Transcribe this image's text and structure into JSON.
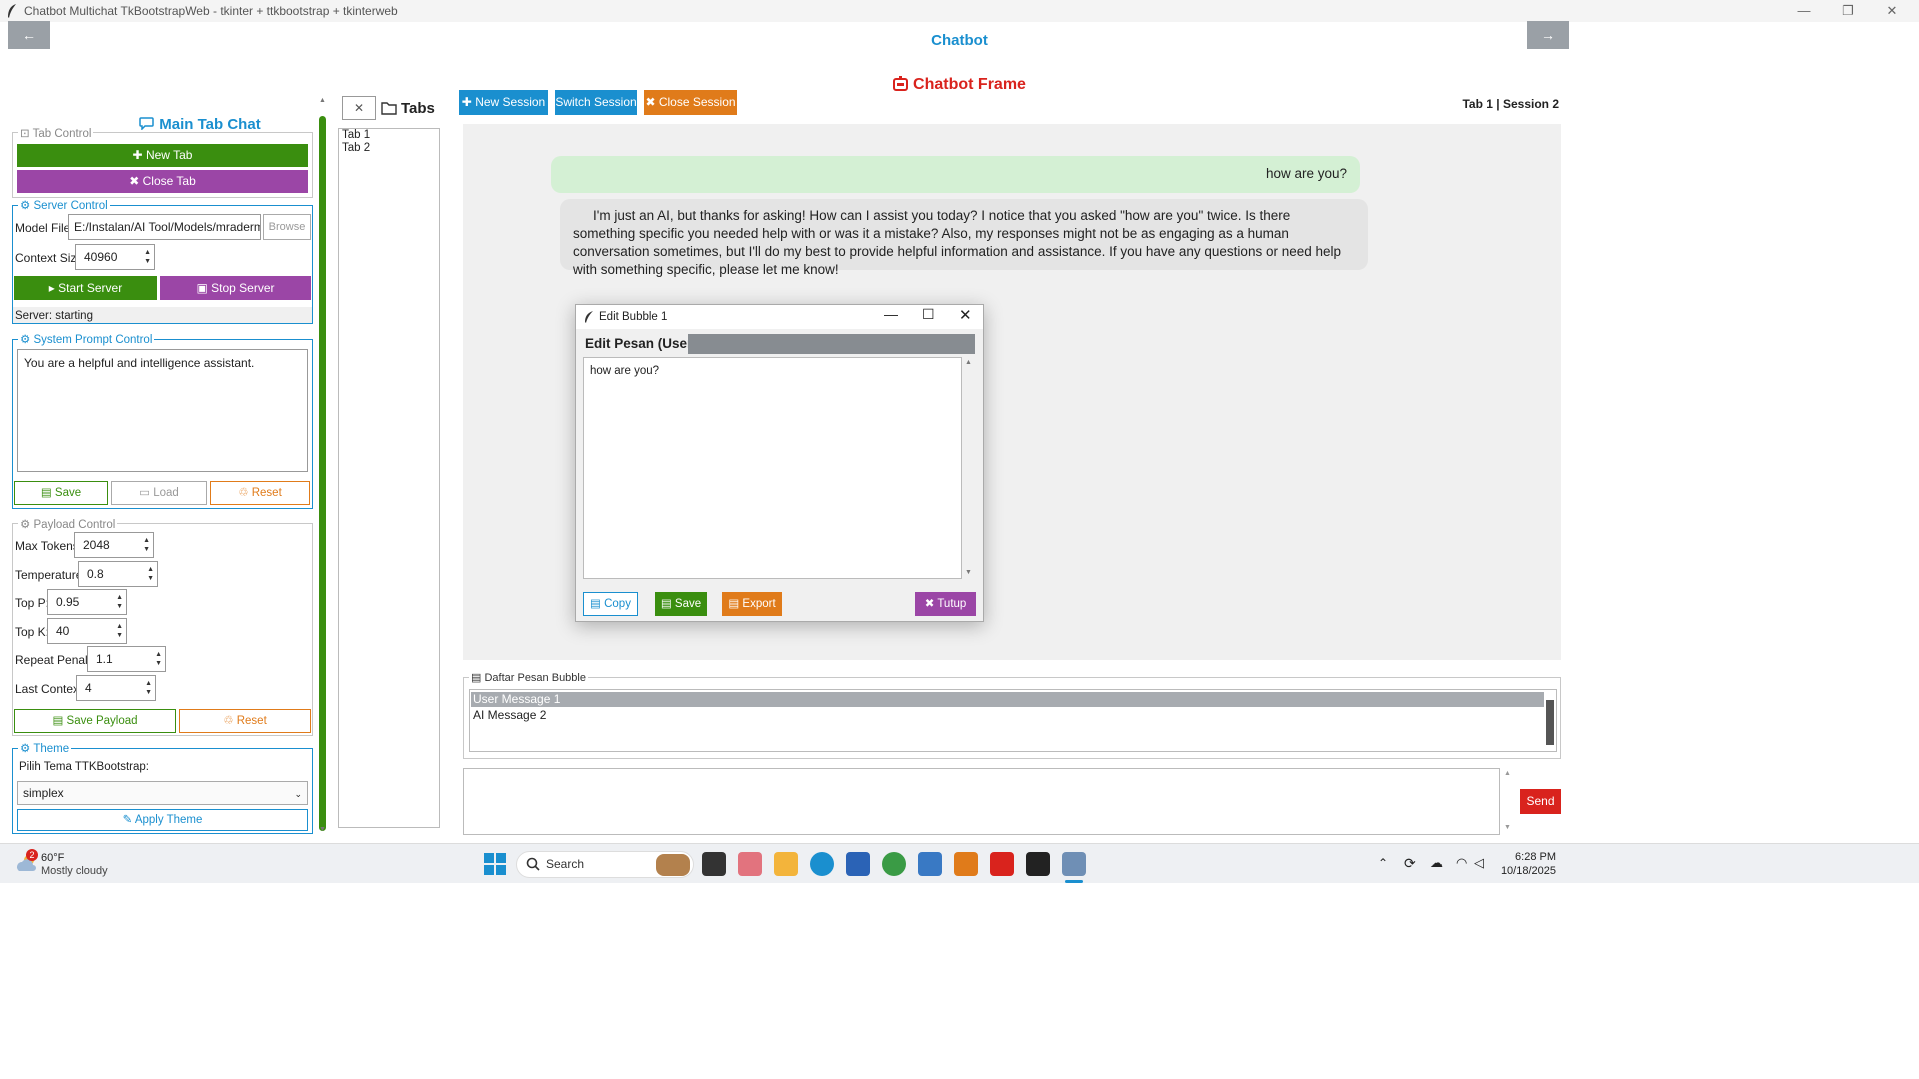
{
  "window": {
    "title": "Chatbot Multichat TkBootstrapWeb - tkinter + ttkbootstrap + tkinterweb",
    "minimize": "—",
    "maximize": "❐",
    "close": "✕"
  },
  "header": {
    "back_label": "←",
    "forward_label": "→",
    "title": "Chatbot",
    "frame_title": "Chatbot Frame"
  },
  "left_panel": {
    "title": "Main Tab Chat",
    "tab_control": {
      "label": "Tab Control",
      "new_tab": "New Tab",
      "close_tab": "Close Tab"
    },
    "server_control": {
      "label": "Server Control",
      "model_file_label": "Model File:",
      "model_file_value": "E:/Instalan/AI Tool/Models/mradermacher",
      "browse": "Browse",
      "context_size_label": "Context Size:",
      "context_size_value": "40960",
      "start_server": "Start Server",
      "stop_server": "Stop Server",
      "status": "Server: starting"
    },
    "system_prompt": {
      "label": "System Prompt Control",
      "text": "You are a helpful and intelligence assistant.",
      "save": "Save",
      "load": "Load",
      "reset": "Reset"
    },
    "payload_control": {
      "label": "Payload Control",
      "max_tokens_label": "Max Tokens:",
      "max_tokens_value": "2048",
      "temperature_label": "Temperature:",
      "temperature_value": "0.8",
      "top_p_label": "Top P:",
      "top_p_value": "0.95",
      "top_k_label": "Top K:",
      "top_k_value": "40",
      "repeat_penalty_label": "Repeat Penalty:",
      "repeat_penalty_value": "1.1",
      "last_context_label": "Last Context:",
      "last_context_value": "4",
      "save_payload": "Save Payload",
      "reset": "Reset"
    },
    "theme": {
      "label": "Theme",
      "pick_label": "Pilih Tema TTKBootstrap:",
      "selected": "simplex",
      "apply": "Apply Theme"
    }
  },
  "tabs_panel": {
    "close_label": "✕",
    "title": "Tabs",
    "items": [
      "Tab 1",
      "Tab 2"
    ]
  },
  "session_bar": {
    "new_session": "New Session",
    "switch_session": "Switch Session",
    "close_session": "Close Session",
    "indicator": "Tab 1 | Session 2"
  },
  "chat": {
    "user_message": "how are you?",
    "ai_message": "I'm just an AI, but thanks for asking! How can I assist you today? I notice that you asked \"how are you\" twice. Is there something specific you needed help with or was it a mistake? Also, my responses might not be as engaging as a human conversation sometimes, but I'll do my best to provide helpful information and assistance. If you have any questions or need help with something specific, please let me know!"
  },
  "bubble_list": {
    "label": "Daftar Pesan Bubble",
    "items": [
      "User Message 1",
      "AI Message 2"
    ]
  },
  "input": {
    "send": "Send"
  },
  "dialog": {
    "title": "Edit Bubble 1",
    "heading": "Edit Pesan (User):",
    "text": "how are you?",
    "copy": "Copy",
    "save": "Save",
    "export": "Export",
    "close": "Tutup"
  },
  "taskbar": {
    "weather_temp": "60°F",
    "weather_desc": "Mostly cloudy",
    "weather_badge": "2",
    "search": "Search",
    "time": "6:28 PM",
    "date": "10/18/2025"
  },
  "colors": {
    "primary": "#1a8fcf",
    "success": "#3a8e0f",
    "purple": "#9b46a6",
    "warning": "#e07b1a",
    "danger": "#d9231d",
    "user_bubble": "#d4f0d4",
    "ai_bubble": "#e4e4e4"
  }
}
